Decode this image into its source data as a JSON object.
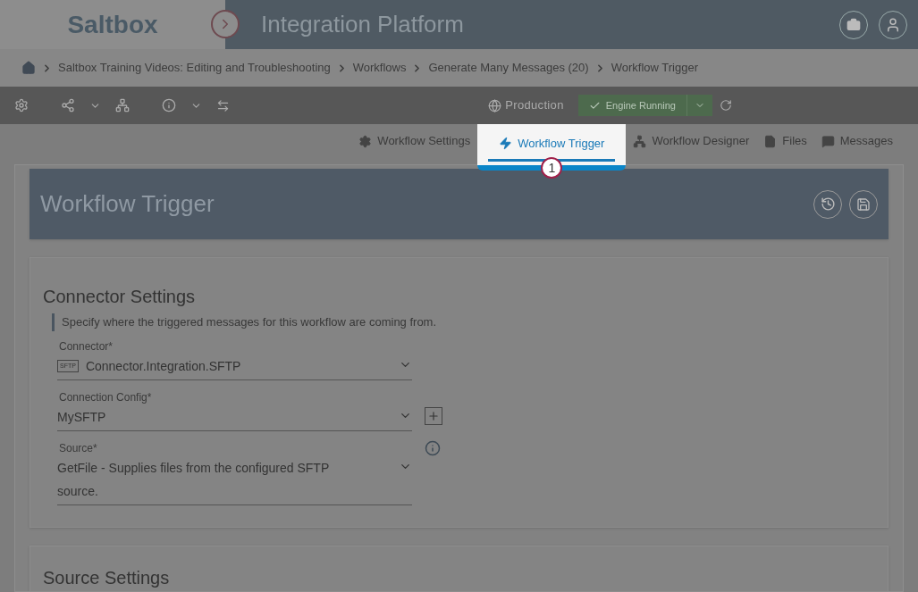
{
  "header": {
    "logo": "Saltbox",
    "title": "Integration Platform"
  },
  "breadcrumbs": [
    "Saltbox Training Videos: Editing and Troubleshooting",
    "Workflows",
    "Generate Many Messages (20)",
    "Workflow Trigger"
  ],
  "toolbar": {
    "environment": "Production",
    "engine_status": "Engine Running"
  },
  "tabs": [
    {
      "label": "Workflow Settings",
      "selected": false
    },
    {
      "label": "Workflow Trigger",
      "selected": true
    },
    {
      "label": "Workflow Designer",
      "selected": false
    },
    {
      "label": "Files",
      "selected": false
    },
    {
      "label": "Messages",
      "selected": false
    }
  ],
  "callout": "1",
  "page_title": "Workflow Trigger",
  "connector_settings": {
    "title": "Connector Settings",
    "description": "Specify where the triggered messages for this workflow are coming from.",
    "fields": [
      {
        "label": "Connector*",
        "value": "Connector.Integration.SFTP",
        "kind": "connector",
        "icon_label": "SFTP"
      },
      {
        "label": "Connection Config*",
        "value": "MySFTP",
        "kind": "add"
      },
      {
        "label": "Source*",
        "value": "GetFile - Supplies files from the configured SFTP source.",
        "kind": "info"
      }
    ]
  },
  "source_settings": {
    "title": "Source Settings"
  }
}
